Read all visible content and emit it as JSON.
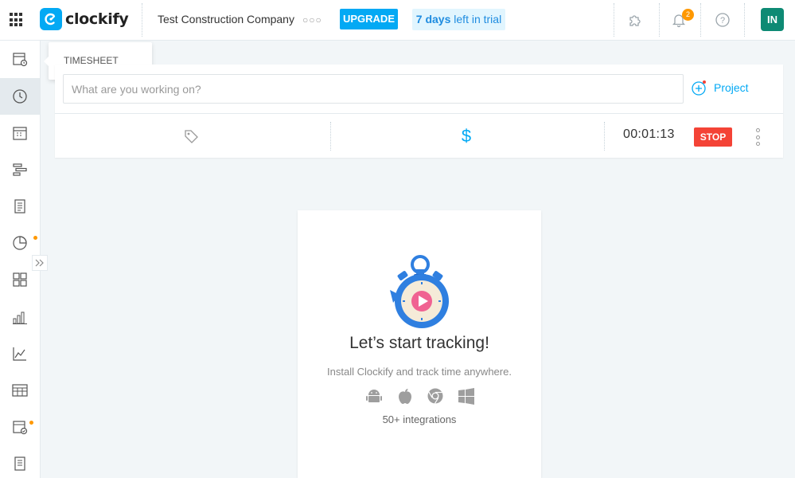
{
  "app": {
    "name": "clockify",
    "accent": "#03a9f4"
  },
  "header": {
    "workspace": "Test Construction Company",
    "upgrade_label": "UPGRADE",
    "trial_days": "7 days",
    "trial_suffix": " left in trial",
    "notifications_count": "2",
    "avatar_initials": "IN"
  },
  "sidebar": {
    "items": [
      {
        "icon": "timesheet-icon",
        "label": "TIMESHEET"
      },
      {
        "icon": "clock-icon",
        "label": "Time tracker",
        "active": true
      },
      {
        "icon": "calendar-icon",
        "label": "Calendar"
      },
      {
        "icon": "schedule-icon",
        "label": "Schedule"
      },
      {
        "icon": "expenses-icon",
        "label": "Expenses"
      },
      {
        "icon": "time-off-icon",
        "label": "Time off",
        "dot": true
      },
      {
        "icon": "dashboard-icon",
        "label": "Dashboard"
      },
      {
        "icon": "reports-icon",
        "label": "Reports"
      },
      {
        "icon": "activity-icon",
        "label": "Activity"
      },
      {
        "icon": "kiosk-icon",
        "label": "Kiosk"
      },
      {
        "icon": "approvals-icon",
        "label": "Approvals",
        "dot": true
      },
      {
        "icon": "invoices-icon",
        "label": "Invoices"
      }
    ],
    "tooltip": "TIMESHEET"
  },
  "tracker": {
    "placeholder": "What are you working on?",
    "project_label": "Project",
    "billable_symbol": "$",
    "timer": "00:01:13",
    "stop_label": "STOP"
  },
  "empty_state": {
    "title": "Let’s start tracking!",
    "subtitle": "Install Clockify and track time anywhere.",
    "integrations": "50+ integrations"
  },
  "colors": {
    "stop": "#f44336",
    "badge": "#ff9800",
    "avatar": "#0e8a74",
    "trial_bg": "#e1f5fe"
  }
}
